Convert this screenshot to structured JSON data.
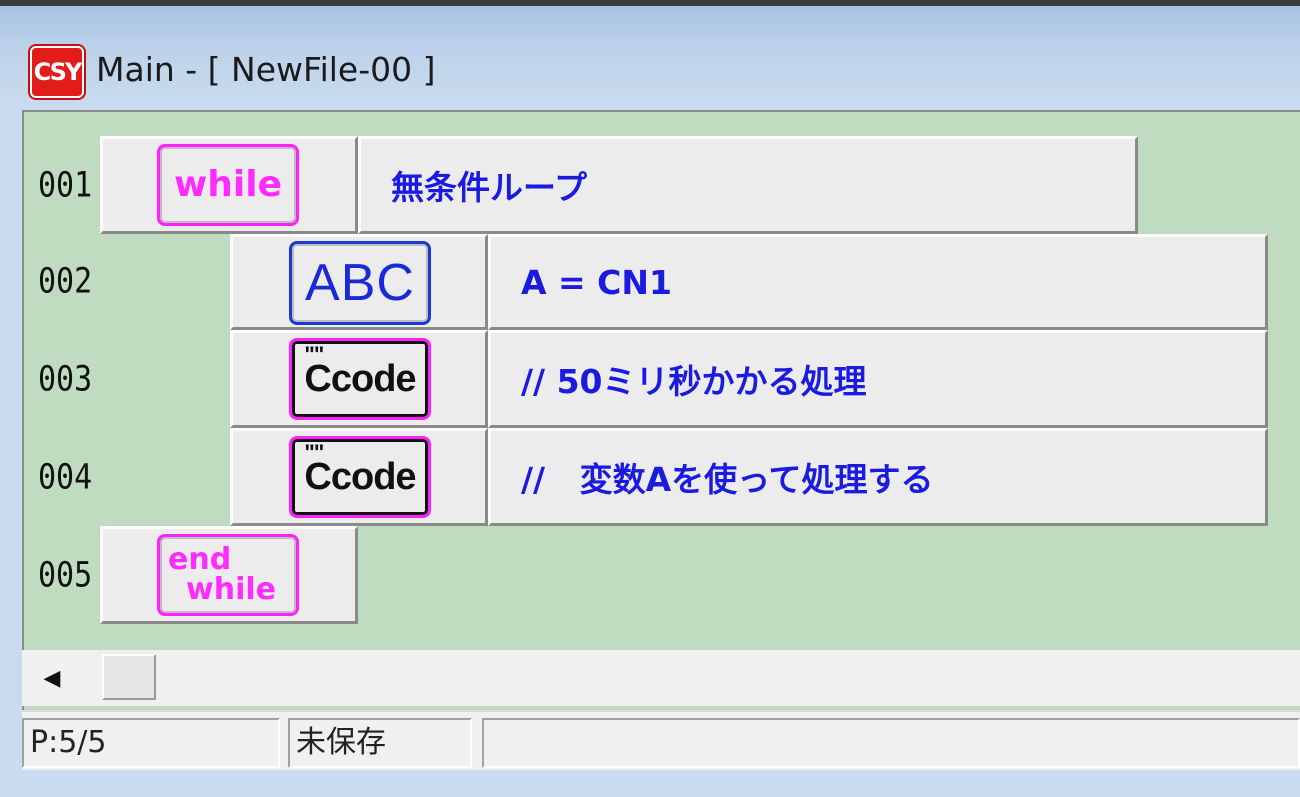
{
  "window": {
    "title": "Main - [ NewFile-00 ]",
    "icon": "csy-app-icon",
    "icon_text": "CSY"
  },
  "colors": {
    "background": "#c0dcc0",
    "keyword": "#ff2bff",
    "text": "#1a1ae0",
    "abc": "#1a2ad8"
  },
  "rows": [
    {
      "line": "001",
      "block": "while",
      "block_label": "while",
      "text": "無条件ループ",
      "indent": 0
    },
    {
      "line": "002",
      "block": "assign",
      "block_label": "ABC",
      "text": "A = CN1",
      "indent": 1
    },
    {
      "line": "003",
      "block": "ccode",
      "block_label": "Ccode",
      "text": "// 50ミリ秒かかる処理",
      "indent": 1
    },
    {
      "line": "004",
      "block": "ccode",
      "block_label": "Ccode",
      "text": "//   変数Aを使って処理する",
      "indent": 1
    },
    {
      "line": "005",
      "block": "endwhile",
      "block_label_line1": "end",
      "block_label_line2": "while",
      "indent": 0
    }
  ],
  "ccode_quote": "\"\"",
  "status": {
    "position": "P:5/5",
    "save_state": "未保存",
    "extra": ""
  }
}
